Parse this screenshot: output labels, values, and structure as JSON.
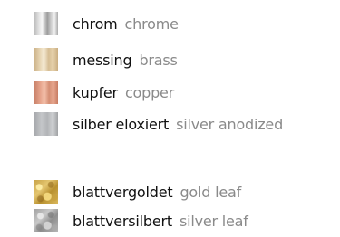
{
  "finishes": [
    {
      "de": "chrom",
      "en": "chrome",
      "swatch_icon": "chrome-swatch",
      "colors": [
        "#bdbdbd",
        "#f7f7f7",
        "#9c9c9c"
      ]
    },
    {
      "de": "messing",
      "en": "brass",
      "swatch_icon": "brass-swatch",
      "colors": [
        "#cdb38a",
        "#f5ead4",
        "#c9ad80"
      ]
    },
    {
      "de": "kupfer",
      "en": "copper",
      "swatch_icon": "copper-swatch",
      "colors": [
        "#c9826a",
        "#f3c0aa",
        "#c67b62"
      ]
    },
    {
      "de": "silber eloxiert",
      "en": "silver anodized",
      "swatch_icon": "silver-anodized-swatch",
      "colors": [
        "#a7a9ac",
        "#cfd1d3",
        "#9fa1a4"
      ]
    },
    {
      "de": "blattvergoldet",
      "en": "gold leaf",
      "swatch_icon": "gold-leaf-swatch",
      "colors": [
        "#c9a448",
        "#e4c670",
        "#b8902e"
      ]
    },
    {
      "de": "blattversilbert",
      "en": "silver leaf",
      "swatch_icon": "silver-leaf-swatch",
      "colors": [
        "#a3a3a3",
        "#c8c8c8",
        "#8e8e8e"
      ]
    }
  ],
  "text_colors": {
    "german": "#111111",
    "english": "#8a8a8a"
  }
}
